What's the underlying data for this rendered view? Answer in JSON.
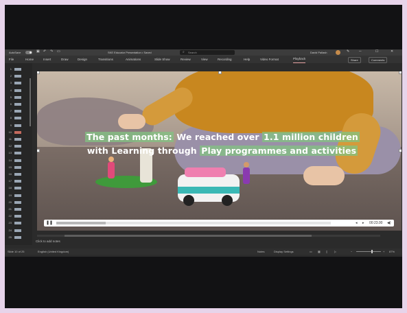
{
  "titlebar": {
    "autosave_label": "AutoSave",
    "autosave_state": "On",
    "doc_title": "SKE Educator Presentation • Saved",
    "search_placeholder": "Search",
    "user_name": "David Pallash"
  },
  "menu": {
    "tabs": [
      "File",
      "Home",
      "Insert",
      "Draw",
      "Design",
      "Transitions",
      "Animations",
      "Slide Show",
      "Review",
      "View",
      "Recording",
      "Help",
      "Video Format",
      "Playback"
    ],
    "share_label": "Share",
    "comments_label": "Comments"
  },
  "thumbnails": {
    "numbers": [
      "1",
      "2",
      "3",
      "4",
      "5",
      "6",
      "7",
      "8",
      "9",
      "10",
      "11",
      "12",
      "13",
      "14",
      "15",
      "16",
      "17",
      "18",
      "19",
      "20",
      "21",
      "22",
      "23",
      "24",
      "25"
    ],
    "active_index": 9
  },
  "slide": {
    "caption_line1_hl": "The past months:",
    "caption_line1_rest": " We reached over ",
    "caption_line1_hl2": "1.1 million children",
    "caption_line2_pre": "with Learning through ",
    "caption_line2_hl": "Play programmes and activities"
  },
  "video": {
    "time": "00:23.00",
    "progress": 0.18
  },
  "notes_placeholder": "Click to add notes",
  "status": {
    "slide_count": "Slide 10 of 25",
    "language": "English (United Kingdom)",
    "notes_label": "Notes",
    "display_settings": "Display Settings",
    "zoom": "87%"
  },
  "colors": {
    "caption_highlight": "#82c382",
    "frame_border": "#e7d4ea"
  }
}
